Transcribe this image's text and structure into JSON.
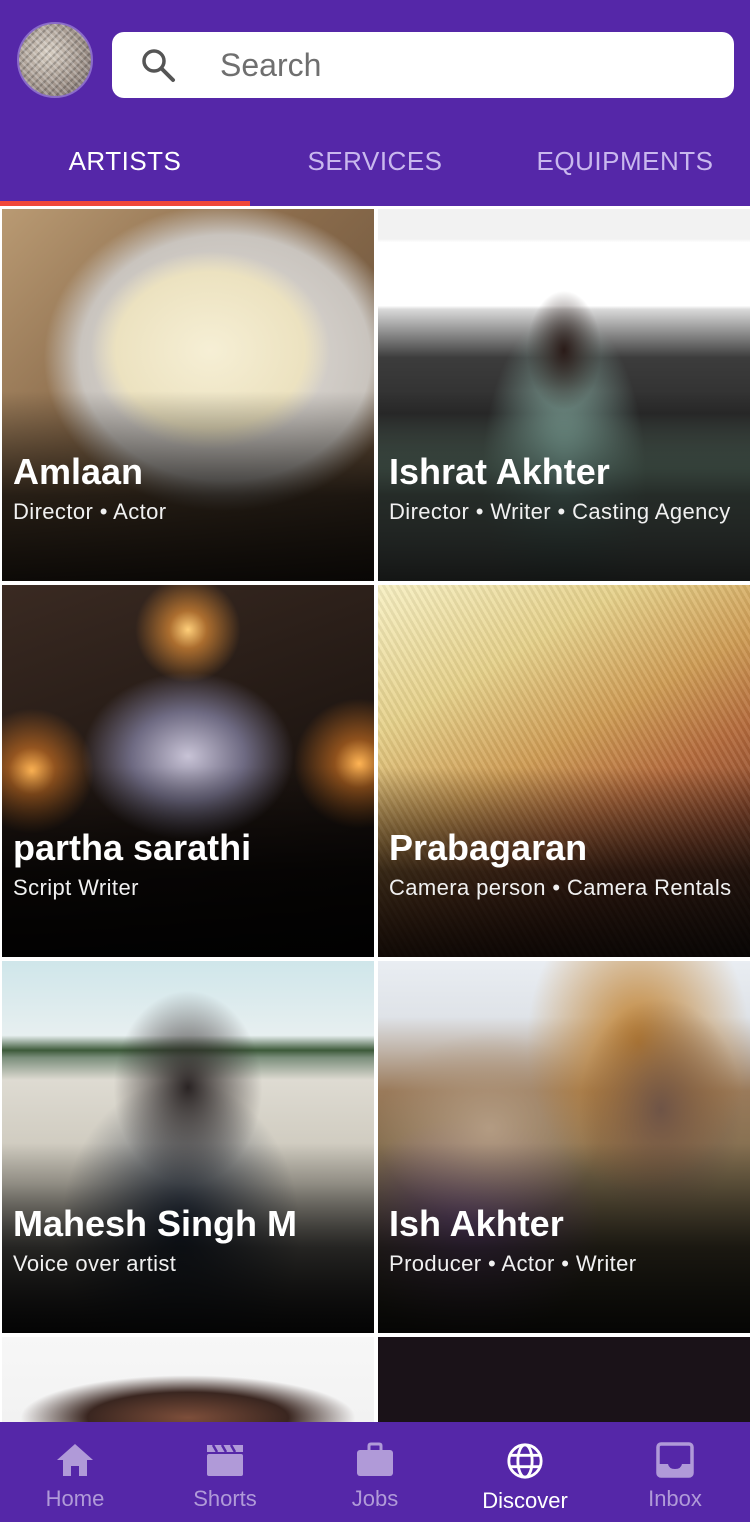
{
  "header": {
    "search_placeholder": "Search"
  },
  "tabs": [
    {
      "label": "ARTISTS",
      "active": true
    },
    {
      "label": "SERVICES",
      "active": false
    },
    {
      "label": "EQUIPMENTS",
      "active": false
    }
  ],
  "artists": [
    {
      "name": "Amlaan",
      "roles": "Director • Actor"
    },
    {
      "name": "Ishrat Akhter",
      "roles": "Director • Writer • Casting Agency"
    },
    {
      "name": "partha sarathi",
      "roles": "Script Writer"
    },
    {
      "name": "Prabagaran",
      "roles": "Camera person • Camera Rentals"
    },
    {
      "name": "Mahesh Singh M",
      "roles": "Voice over artist"
    },
    {
      "name": "Ish Akhter",
      "roles": "Producer • Actor • Writer"
    }
  ],
  "bottom_nav": [
    {
      "label": "Home",
      "icon": "home-icon",
      "active": false
    },
    {
      "label": "Shorts",
      "icon": "clapperboard-icon",
      "active": false
    },
    {
      "label": "Jobs",
      "icon": "briefcase-icon",
      "active": false
    },
    {
      "label": "Discover",
      "icon": "globe-icon",
      "active": true
    },
    {
      "label": "Inbox",
      "icon": "inbox-icon",
      "active": false
    }
  ],
  "colors": {
    "primary": "#5527a8",
    "tab_indicator": "#f0473a",
    "inactive_text": "#c9b8ee"
  }
}
